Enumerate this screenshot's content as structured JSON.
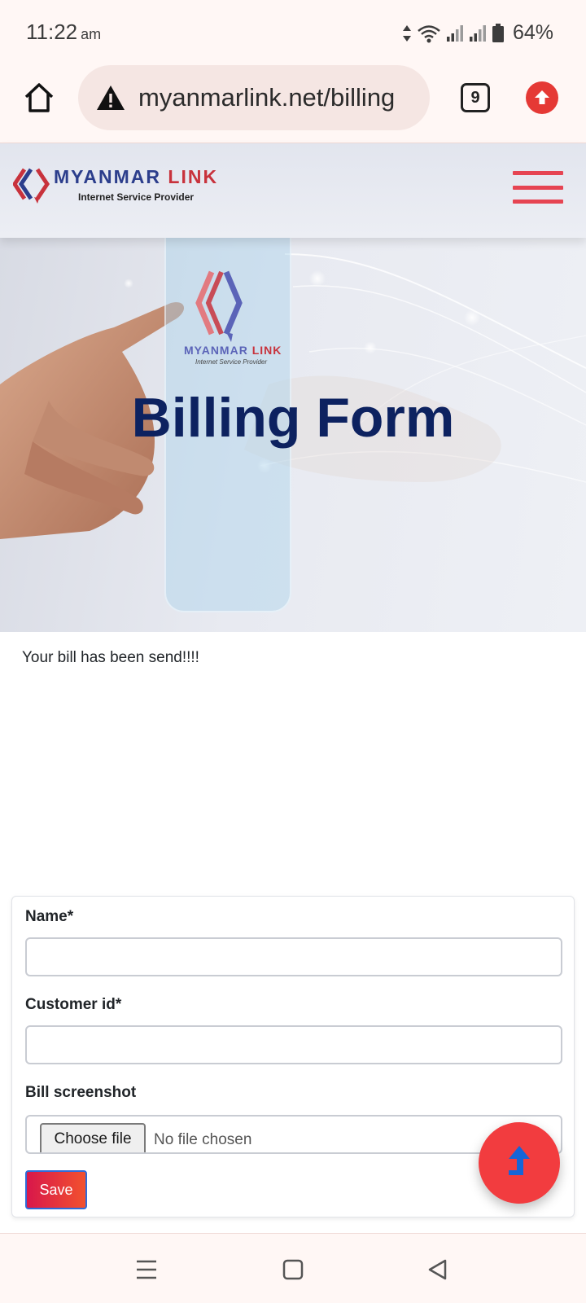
{
  "status_bar": {
    "time": "11:22",
    "ampm": "am",
    "battery": "64%"
  },
  "browser": {
    "url": "myanmarlink.net/billing",
    "tab_count": "9"
  },
  "header": {
    "logo_name_main": "MYANMAR",
    "logo_name_accent": "LINK",
    "logo_tagline": "Internet Service Provider"
  },
  "hero": {
    "title": "Billing Form",
    "logo_name_main": "MYANMAR",
    "logo_name_accent": "LINK",
    "logo_tagline": "Internet Service Provider"
  },
  "message": "Your bill has been send!!!!",
  "form": {
    "name_label": "Name*",
    "name_value": "",
    "customer_id_label": "Customer id*",
    "customer_id_value": "",
    "screenshot_label": "Bill screenshot",
    "file_button": "Choose file",
    "file_status": "No file chosen",
    "save_label": "Save"
  },
  "colors": {
    "brand_navy": "#0d2260",
    "brand_red": "#e64452",
    "fab": "#f23c3f"
  },
  "icons": {
    "home": "home-icon",
    "warning": "warning-icon",
    "upload": "upload-icon",
    "menu": "hamburger-menu-icon",
    "scroll_top": "arrow-up-icon"
  }
}
